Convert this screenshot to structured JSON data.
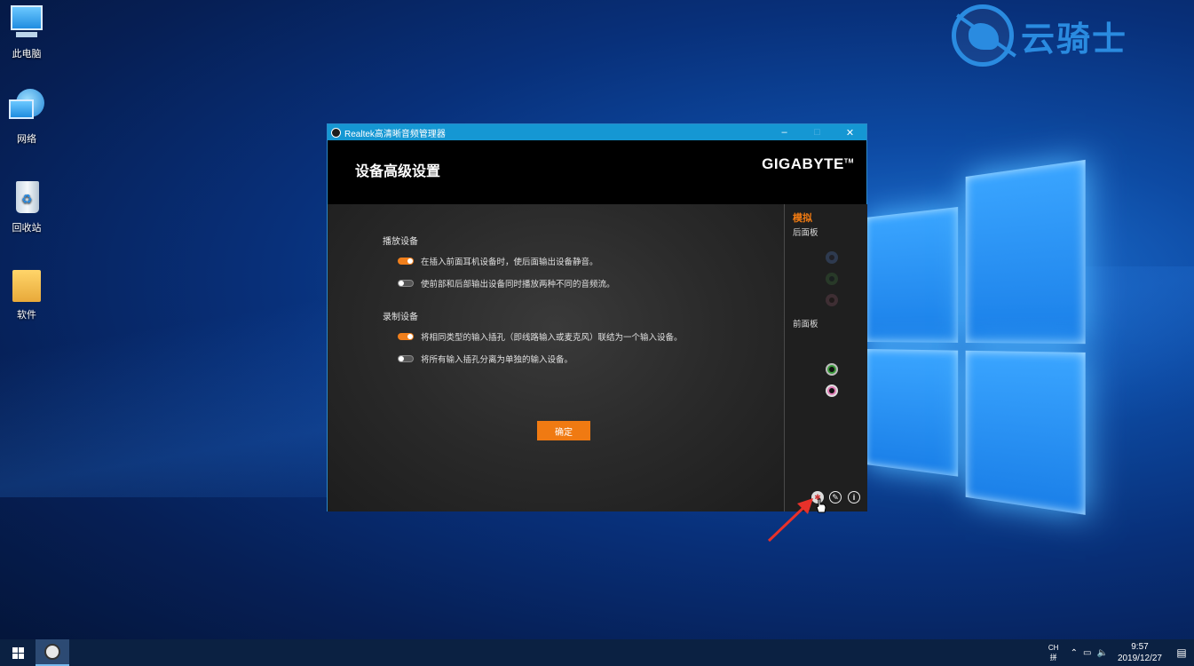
{
  "watermark": {
    "text": "云骑士"
  },
  "desktop": {
    "icons": [
      {
        "label": "此电脑"
      },
      {
        "label": "网络"
      },
      {
        "label": "回收站"
      },
      {
        "label": "软件"
      }
    ]
  },
  "window": {
    "title": "Realtek高清晰音频管理器",
    "minimize": "–",
    "maximize": "□",
    "close": "✕",
    "header_title": "设备高级设置",
    "brand_logo": "GIGABYTE",
    "brand_tm": "TM"
  },
  "settings": {
    "playback": {
      "label": "播放设备",
      "options": [
        {
          "text": "在插入前面耳机设备时，使后面输出设备静音。",
          "enabled": true
        },
        {
          "text": "使前部和后部输出设备同时播放两种不同的音频流。",
          "enabled": false
        }
      ]
    },
    "recording": {
      "label": "录制设备",
      "options": [
        {
          "text": "将相同类型的输入插孔（即线路输入或麦克风）联结为一个输入设备。",
          "enabled": true
        },
        {
          "text": "将所有输入插孔分离为单独的输入设备。",
          "enabled": false
        }
      ]
    },
    "ok_button": "确定"
  },
  "side_panel": {
    "analog_label": "模拟",
    "rear_label": "后面板",
    "front_label": "前面板",
    "tools": [
      {
        "icon": "gear-icon"
      },
      {
        "icon": "wrench-icon"
      },
      {
        "icon": "info-icon"
      }
    ]
  },
  "taskbar": {
    "ime_top": "CH",
    "ime_bottom": "拼",
    "time": "9:57",
    "date": "2019/12/27"
  },
  "colors": {
    "accent_orange": "#f07a12",
    "titlebar_blue": "#1597d3",
    "jack_green": "#3a9a3a",
    "jack_pink": "#e07bb5",
    "jack_blue": "#4a6ea8"
  }
}
